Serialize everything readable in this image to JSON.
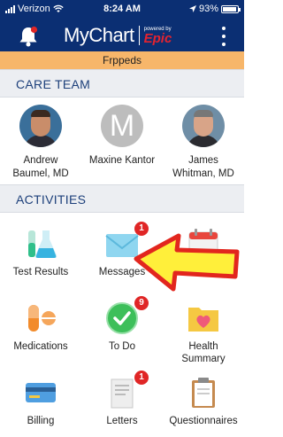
{
  "status_bar": {
    "carrier": "Verizon",
    "time": "8:24 AM",
    "battery_text": "93%",
    "battery_level": 0.93
  },
  "header": {
    "brand": "MyChart",
    "powered_by": "powered by",
    "epic": "Epic"
  },
  "patient_banner": {
    "name": "Frppeds"
  },
  "care_team": {
    "title": "CARE TEAM",
    "members": [
      {
        "name_line1": "Andrew",
        "name_line2": "Baumel, MD",
        "avatar": "photo"
      },
      {
        "name_line1": "Maxine Kantor",
        "name_line2": "",
        "avatar": "initial",
        "initial": "M"
      },
      {
        "name_line1": "James",
        "name_line2": "Whitman, MD",
        "avatar": "photo"
      }
    ]
  },
  "activities": {
    "title": "ACTIVITIES",
    "tiles": [
      {
        "label": "Test Results",
        "icon": "flask-icon",
        "badge": ""
      },
      {
        "label": "Messages",
        "icon": "envelope-icon",
        "badge": "1"
      },
      {
        "label": "ts",
        "icon": "calendar-icon",
        "badge": ""
      },
      {
        "label": "Medications",
        "icon": "pill-icon",
        "badge": ""
      },
      {
        "label": "To Do",
        "icon": "checkmark-icon",
        "badge": "9"
      },
      {
        "label": "Health\nSummary",
        "label_line1": "Health",
        "label_line2": "Summary",
        "icon": "heart-folder-icon",
        "badge": ""
      },
      {
        "label": "Billing",
        "icon": "credit-card-icon",
        "badge": ""
      },
      {
        "label": "Letters",
        "icon": "letter-icon",
        "badge": "1"
      },
      {
        "label": "Questionnaires",
        "icon": "clipboard-icon",
        "badge": ""
      }
    ]
  },
  "colors": {
    "header_bg": "#0b2f73",
    "banner_bg": "#f7b66a",
    "badge_red": "#e02626",
    "arrow_yellow": "#ffef3a",
    "arrow_red": "#e2261e"
  }
}
